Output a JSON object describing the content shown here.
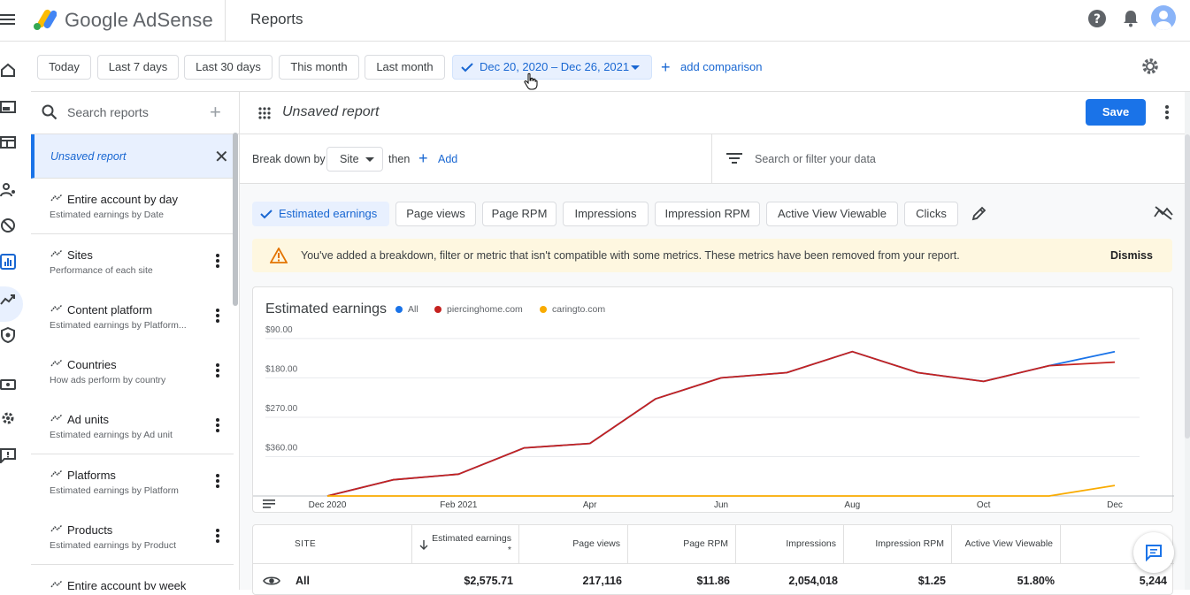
{
  "app": {
    "brand": "Google AdSense",
    "page_title": "Reports"
  },
  "colors": {
    "primary": "#1a73e8",
    "all_series": "#1a73e8",
    "piercinghome": "#c5221f",
    "caringto": "#f9ab00",
    "warning_bg": "#fef7e0"
  },
  "date_ranges": {
    "today": "Today",
    "last7": "Last 7 days",
    "last30": "Last 30 days",
    "this_month": "This month",
    "last_month": "Last month",
    "selected": "Dec 20, 2020 – Dec 26, 2021",
    "add_comparison": "add comparison"
  },
  "sidebar": {
    "search_placeholder": "Search reports",
    "active_report": "Unsaved report",
    "reports": [
      {
        "title": "Entire account by day",
        "subtitle": "Estimated earnings by Date"
      },
      {
        "title": "Sites",
        "subtitle": "Performance of each site"
      },
      {
        "title": "Content platform",
        "subtitle": "Estimated earnings by Platform..."
      },
      {
        "title": "Countries",
        "subtitle": "How ads perform by country"
      },
      {
        "title": "Ad units",
        "subtitle": "Estimated earnings by Ad unit"
      },
      {
        "title": "Platforms",
        "subtitle": "Estimated earnings by Platform"
      },
      {
        "title": "Products",
        "subtitle": "Estimated earnings by Product"
      },
      {
        "title": "Entire account by week",
        "subtitle": ""
      }
    ]
  },
  "report": {
    "title": "Unsaved report",
    "save_label": "Save",
    "breakdown_label": "Break down by",
    "breakdown_value": "Site",
    "then_label": "then",
    "add_label": "Add",
    "filter_placeholder": "Search or filter your data"
  },
  "metrics": [
    "Estimated earnings",
    "Page views",
    "Page RPM",
    "Impressions",
    "Impression RPM",
    "Active View Viewable",
    "Clicks"
  ],
  "selected_metric": "Estimated earnings",
  "warning": {
    "text": "You've added a breakdown, filter or metric that isn't compatible with some metrics. These metrics have been removed from your report.",
    "dismiss": "Dismiss"
  },
  "chart_data": {
    "type": "line",
    "title": "Estimated earnings",
    "x": [
      "Dec 2020",
      "Jan 2021",
      "Feb 2021",
      "Mar 2021",
      "Apr 2021",
      "May 2021",
      "Jun 2021",
      "Jul 2021",
      "Aug 2021",
      "Sep 2021",
      "Oct 2021",
      "Nov 2021",
      "Dec 2021"
    ],
    "x_tick_labels": [
      "Dec 2020",
      "Feb 2021",
      "Apr",
      "Jun",
      "Aug",
      "Oct",
      "Dec"
    ],
    "y_tick_labels": [
      "$360.00",
      "$270.00",
      "$180.00",
      "$90.00"
    ],
    "y_ticks": [
      90,
      180,
      270,
      360
    ],
    "ylim": [
      0,
      380
    ],
    "series": [
      {
        "name": "All",
        "values": [
          0,
          37,
          50,
          110,
          120,
          222,
          270,
          282,
          330,
          282,
          262,
          298,
          330
        ]
      },
      {
        "name": "piercinghome.com",
        "values": [
          0,
          37,
          50,
          110,
          120,
          222,
          270,
          282,
          330,
          282,
          262,
          298,
          306
        ]
      },
      {
        "name": "caringto.com",
        "values": [
          0,
          0,
          0,
          0,
          0,
          0,
          0,
          0,
          0,
          0,
          0,
          0,
          24
        ]
      }
    ],
    "grid": true
  },
  "table": {
    "headers": [
      "SITE",
      "",
      "Estimated earnings *",
      "Page views",
      "Page RPM",
      "Impressions",
      "Impression RPM",
      "Active View Viewable",
      ""
    ],
    "rows": [
      {
        "site": "All",
        "earnings": "$2,575.71",
        "page_views": "217,116",
        "page_rpm": "$11.86",
        "impressions": "2,054,018",
        "impression_rpm": "$1.25",
        "active_view": "51.80%",
        "clicks": "5,244"
      }
    ]
  }
}
